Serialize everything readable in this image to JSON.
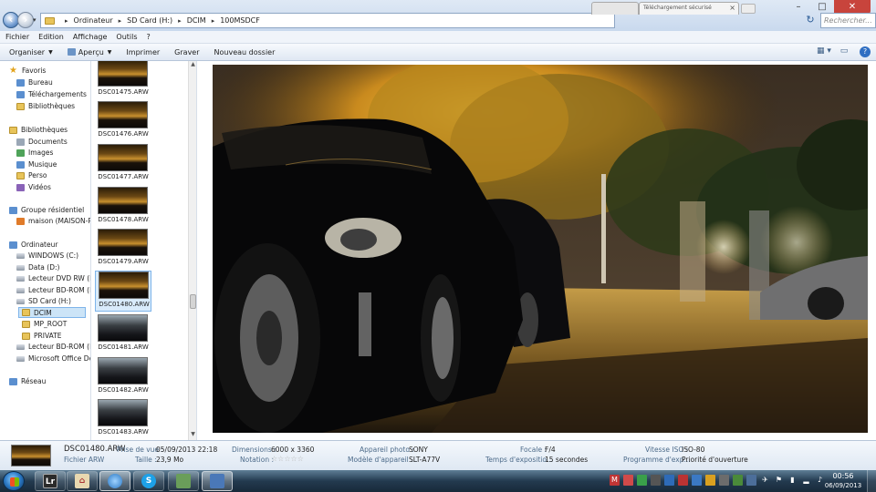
{
  "address": {
    "crumbs": [
      "Ordinateur",
      "SD Card (H:)",
      "DCIM",
      "100MSDCF"
    ],
    "search_placeholder": "Rechercher..."
  },
  "browser_tab": {
    "title": "Téléchargement sécurisé"
  },
  "menu": [
    "Fichier",
    "Edition",
    "Affichage",
    "Outils",
    "?"
  ],
  "commands": {
    "organize": "Organiser",
    "preview": "Aperçu",
    "print": "Imprimer",
    "burn": "Graver",
    "new_folder": "Nouveau dossier"
  },
  "nav": {
    "favorites": "Favoris",
    "desktop": "Bureau",
    "downloads": "Téléchargements",
    "libraries_fav": "Bibliothèques",
    "libraries": "Bibliothèques",
    "documents": "Documents",
    "images": "Images",
    "music": "Musique",
    "perso": "Perso",
    "videos": "Vidéos",
    "homegroup": "Groupe résidentiel",
    "maison": "maison (MAISON-P",
    "computer": "Ordinateur",
    "windows": "WINDOWS (C:)",
    "data": "Data (D:)",
    "dvd": "Lecteur DVD RW (E:)",
    "bd1": "Lecteur BD-ROM (F:",
    "sd": "SD Card (H:)",
    "dcim": "DCIM",
    "mp_root": "MP_ROOT",
    "private": "PRIVATE",
    "bd2": "Lecteur BD-ROM (I:)",
    "office": "Microsoft Office Dé",
    "network": "Réseau"
  },
  "thumbs": [
    "DSC01475.ARW",
    "DSC01476.ARW",
    "DSC01477.ARW",
    "DSC01478.ARW",
    "DSC01479.ARW",
    "DSC01480.ARW",
    "DSC01481.ARW",
    "DSC01482.ARW",
    "DSC01483.ARW"
  ],
  "selected_thumb": "DSC01480.ARW",
  "details": {
    "filename": "DSC01480.ARW",
    "filetype": "Fichier ARW",
    "taken_label": "Prise de vue :",
    "taken_value": "05/09/2013 22:18",
    "size_label": "Taille :",
    "size_value": "23,9 Mo",
    "dims_label": "Dimensions :",
    "dims_value": "6000 x 3360",
    "rating_label": "Notation :",
    "rating_value": 0,
    "camera_label": "Appareil photo :",
    "camera_value": "SONY",
    "model_label": "Modèle d'appareil ...",
    "model_value": "SLT-A77V",
    "focal_label": "Focale :",
    "focal_value": "F/4",
    "exposure_label": "Temps d'expositio...",
    "exposure_value": "15 secondes",
    "iso_label": "Vitesse ISO :",
    "iso_value": "ISO-80",
    "program_label": "Programme d'exp...",
    "program_value": "Priorité d'ouverture"
  },
  "taskbar": {
    "apps": [
      "Lr",
      "home",
      "ie",
      "S",
      "device",
      "control"
    ],
    "clock_time": "00:56",
    "clock_date": "06/09/2013"
  },
  "colors": {
    "accent": "#2b78c4",
    "selection": "#cce4f7",
    "close_button": "#c8443c"
  }
}
